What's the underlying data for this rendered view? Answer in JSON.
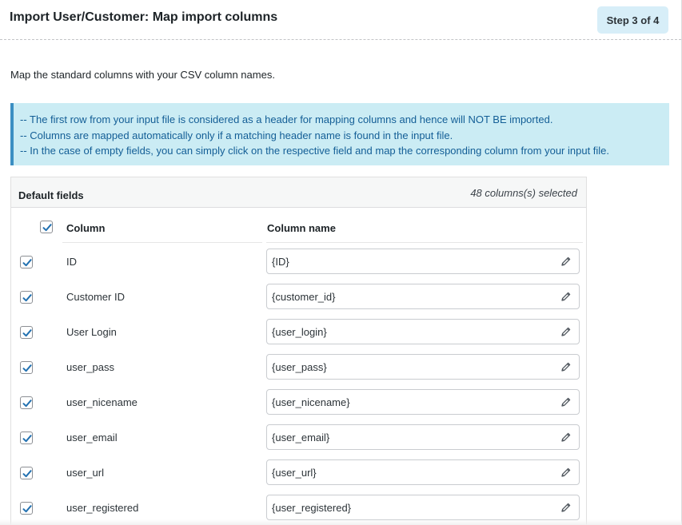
{
  "header": {
    "title": "Import User/Customer: Map import columns",
    "step": "Step 3 of 4"
  },
  "intro_text": "Map the standard columns with your CSV column names.",
  "notice": {
    "lines": [
      "-- The first row from your input file is considered as a header for mapping columns and hence will NOT BE imported.",
      "-- Columns are mapped automatically only if a matching header name is found in the input file.",
      "-- In the case of empty fields, you can simply click on the respective field and map the corresponding column from your input file."
    ]
  },
  "table": {
    "section_label": "Default fields",
    "selected_count": "48 columns(s) selected",
    "column_header": "Column",
    "column_name_header": "Column name",
    "select_all_checked": true,
    "rows": [
      {
        "column": "ID",
        "value": "{ID}",
        "checked": true
      },
      {
        "column": "Customer ID",
        "value": "{customer_id}",
        "checked": true
      },
      {
        "column": "User Login",
        "value": "{user_login}",
        "checked": true
      },
      {
        "column": "user_pass",
        "value": "{user_pass}",
        "checked": true
      },
      {
        "column": "user_nicename",
        "value": "{user_nicename}",
        "checked": true
      },
      {
        "column": "user_email",
        "value": "{user_email}",
        "checked": true
      },
      {
        "column": "user_url",
        "value": "{user_url}",
        "checked": true
      },
      {
        "column": "user_registered",
        "value": "{user_registered}",
        "checked": true
      }
    ]
  },
  "icons": {
    "checkbox": "checkmark-icon",
    "edit": "pencil-icon"
  },
  "colors": {
    "accent": "#2271b1",
    "notice_bg": "#cbecf4",
    "notice_text": "#135e96",
    "step_badge_bg": "#d7eef8"
  }
}
